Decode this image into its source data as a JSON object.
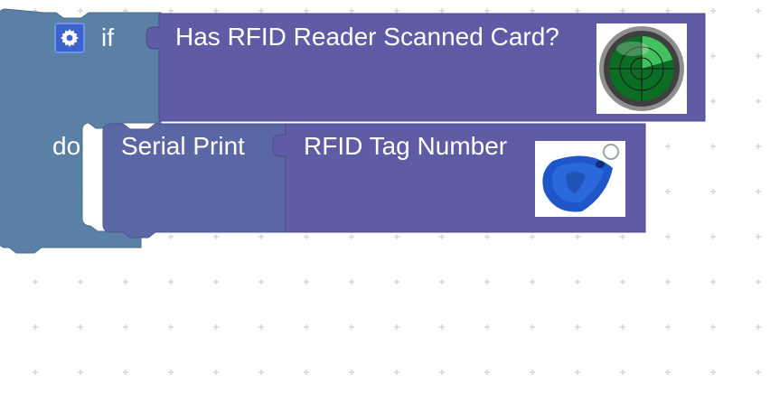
{
  "workspace": {
    "background": "#ffffff",
    "grid_color": "#d2d2d2"
  },
  "if_block": {
    "keyword_if": "if",
    "keyword_do": "do",
    "mutator_icon": "gear-icon",
    "color": "#5b80a5"
  },
  "condition_block": {
    "label": "Has RFID Reader Scanned Card?",
    "image_icon": "radar-icon",
    "color": "#5f5ba5"
  },
  "serial_print_block": {
    "label": "Serial Print",
    "color": "#5b67a5"
  },
  "tag_block": {
    "label": "RFID Tag Number",
    "image_icon": "rfid-keyfob-icon",
    "color": "#5f5ba5"
  }
}
